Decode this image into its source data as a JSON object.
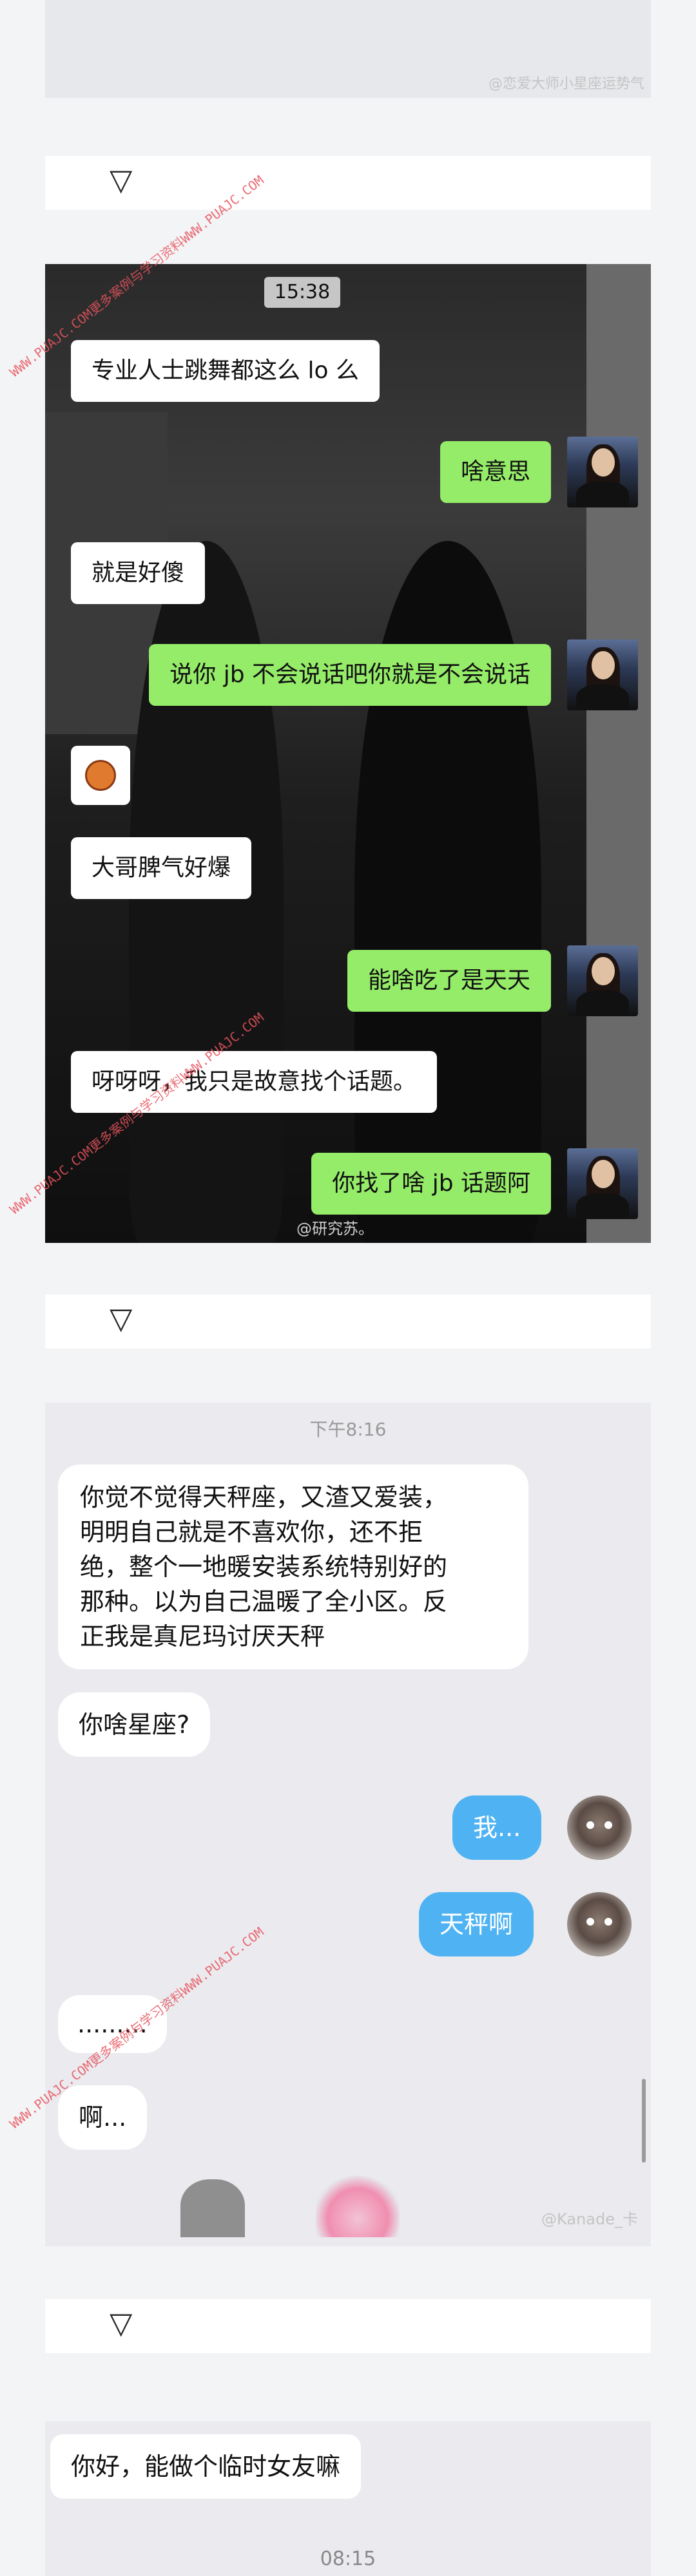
{
  "top_section": {
    "watermark": "@恋爱大师小星座运势气"
  },
  "photo_chat": {
    "time": "15:38",
    "messages": [
      {
        "side": "in",
        "text": "专业人士跳舞都这么 lo 么"
      },
      {
        "side": "out",
        "text": "啥意思"
      },
      {
        "side": "in",
        "text": "就是好傻"
      },
      {
        "side": "out",
        "text": "说你 jb 不会说话吧你就是不会说话"
      },
      {
        "side": "in",
        "emoji": "angry-face"
      },
      {
        "side": "in",
        "text": "大哥脾气好爆"
      },
      {
        "side": "out",
        "text": "能啥吃了是天天"
      },
      {
        "side": "in",
        "text": "呀呀呀，我只是故意找个话题。"
      },
      {
        "side": "out",
        "text": "你找了啥 jb 话题阿"
      }
    ],
    "watermark": "@研究苏。"
  },
  "chat2": {
    "timestamp": "下午8:16",
    "messages": [
      {
        "side": "in",
        "lines": [
          "你觉不觉得天秤座，又渣又爱装，",
          "明明自己就是不喜欢你，还不拒",
          "绝，整个一地暖安装系统特别好的",
          "那种。以为自己温暖了全小区。反",
          "正我是真尼玛讨厌天秤"
        ]
      },
      {
        "side": "in",
        "text": "你啥星座?"
      },
      {
        "side": "out",
        "text": "我..."
      },
      {
        "side": "out",
        "text": "天秤啊"
      },
      {
        "side": "in",
        "text": "........."
      },
      {
        "side": "in",
        "text": "啊..."
      }
    ],
    "watermark": "@Kanade_卡"
  },
  "chat3": {
    "messages": [
      {
        "side": "in",
        "text": "你好，能做个临时女友嘛"
      }
    ],
    "timestamp": "08:15"
  },
  "divider_icon": "triangle-down-icon",
  "site_watermark": "WWW.PUAJC.COM更多案例与学习资料WWW.PUAJC.COM"
}
